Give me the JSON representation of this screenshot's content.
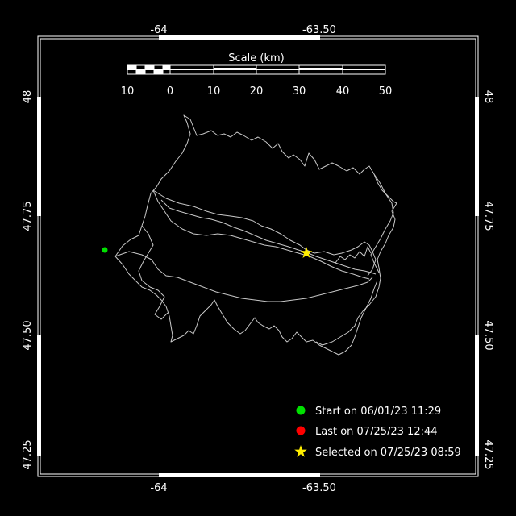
{
  "map": {
    "axes": {
      "lon_ticks": [
        "-64",
        "-63.50"
      ],
      "lat_ticks": [
        "48",
        "47.75",
        "47.50",
        "47.25"
      ]
    },
    "scale_bar": {
      "title": "Scale (km)",
      "labels": [
        "10",
        "0",
        "10",
        "20",
        "30",
        "40",
        "50"
      ]
    },
    "legend": {
      "start": {
        "label": "Start on 06/01/23 11:29",
        "color": "#00e000"
      },
      "last": {
        "label": "Last on 07/25/23 12:44",
        "color": "#ff0000"
      },
      "selected": {
        "label": "Selected on 07/25/23 08:59",
        "color": "#ffee00"
      }
    },
    "track": {
      "color": "#c8c8c8",
      "start_point": {
        "lon": -64.15,
        "lat": 47.665
      },
      "selected_point": {
        "lon": -63.55,
        "lat": 47.66
      }
    },
    "frame_color": "#ffffff",
    "background": "#000000"
  }
}
